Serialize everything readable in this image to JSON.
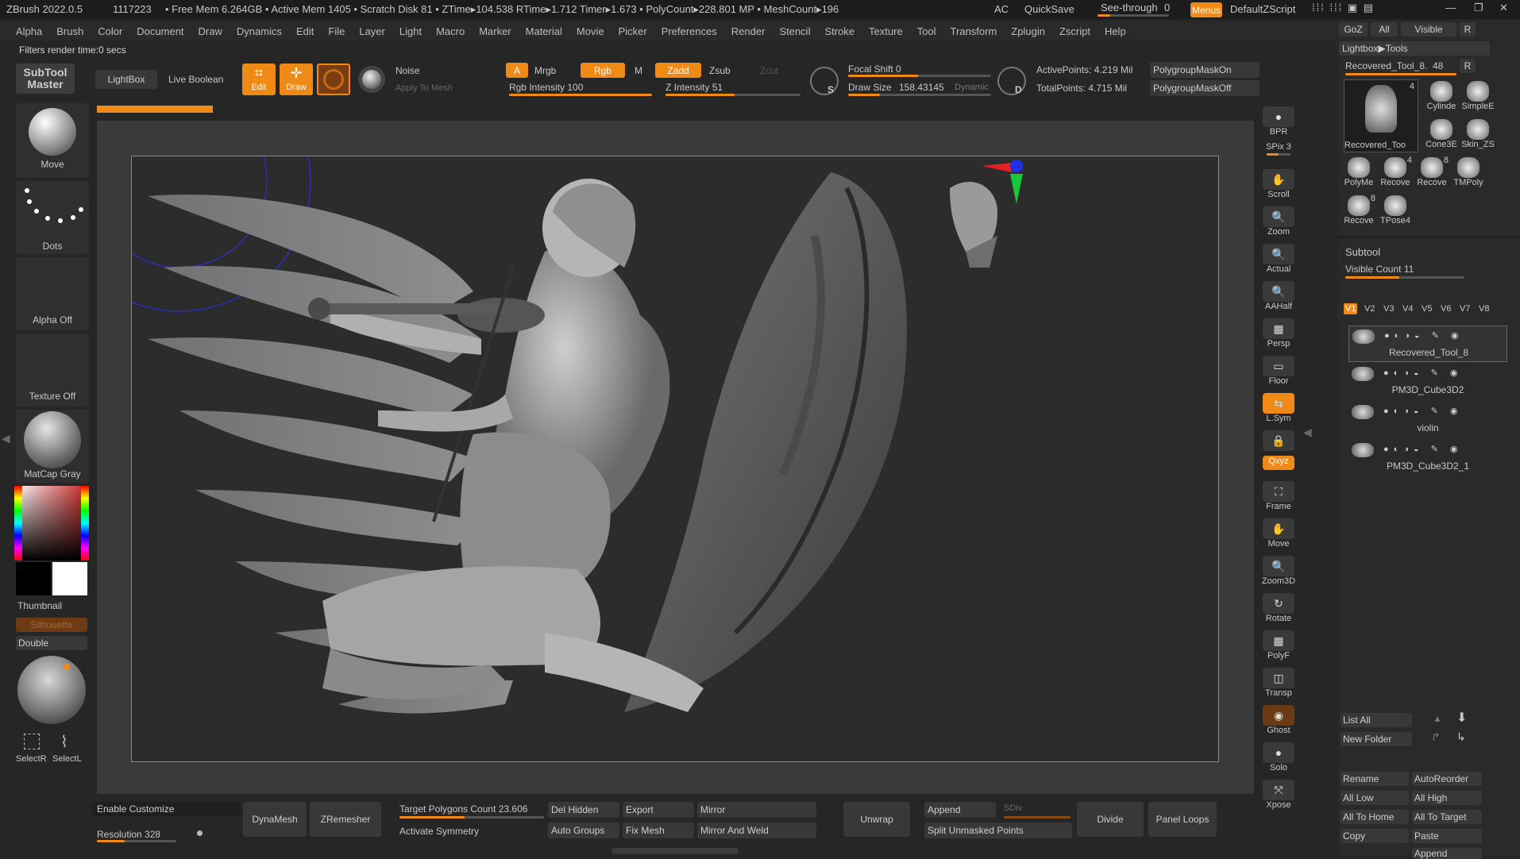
{
  "titlebar": {
    "app": "ZBrush 2022.0.5",
    "id": "1117223",
    "stats": "• Free Mem 6.264GB • Active Mem 1405 • Scratch Disk 81 • ZTime▸104.538 RTime▸1.712 Timer▸1.673 • PolyCount▸228.801 MP • MeshCount▸196",
    "ac": "AC",
    "quicksave": "QuickSave",
    "seethrough": "See-through",
    "seethrough_val": "0",
    "menus": "Menus",
    "script": "DefaultZScript"
  },
  "menus": [
    "Alpha",
    "Brush",
    "Color",
    "Document",
    "Draw",
    "Dynamics",
    "Edit",
    "File",
    "Layer",
    "Light",
    "Macro",
    "Marker",
    "Material",
    "Movie",
    "Picker",
    "Preferences",
    "Render",
    "Stencil",
    "Stroke",
    "Texture",
    "Tool",
    "Transform",
    "Zplugin",
    "Zscript",
    "Help"
  ],
  "status_msg": "Filters render time:0 secs",
  "toolbar": {
    "subtool_master": "SubTool Master",
    "lightbox": "LightBox",
    "live_boolean": "Live Boolean",
    "edit": "Edit",
    "draw": "Draw",
    "noise": "Noise",
    "apply_to_mesh": "Apply To Mesh",
    "a": "A",
    "mrgb": "Mrgb",
    "rgb": "Rgb",
    "m": "M",
    "zadd": "Zadd",
    "zsub": "Zsub",
    "zcut": "Zcut",
    "rgb_intensity": "Rgb Intensity 100",
    "z_intensity": "Z Intensity 51",
    "focal_shift": "Focal Shift 0",
    "draw_size_label": "Draw Size",
    "draw_size_val": "158.43145",
    "dynamic": "Dynamic",
    "s_label": "S",
    "d_label": "D",
    "active_points": "ActivePoints: 4.219 Mil",
    "total_points": "TotalPoints: 4.715 Mil",
    "pg_on": "PolygroupMaskOn",
    "pg_off": "PolygroupMaskOff"
  },
  "progress": {
    "fraction": 0.1
  },
  "left": {
    "move": "Move",
    "dots": "Dots",
    "alpha_off": "Alpha Off",
    "texture_off": "Texture Off",
    "matcap": "MatCap Gray",
    "thumbnail": "Thumbnail",
    "silhouette": "Silhouette",
    "double": "Double",
    "selectr": "SelectR",
    "selectl": "SelectL"
  },
  "right_shelf": [
    {
      "name": "bpr",
      "label": "BPR"
    },
    {
      "name": "spix",
      "label": "SPix 3"
    },
    {
      "name": "scroll",
      "label": "Scroll"
    },
    {
      "name": "zoom",
      "label": "Zoom"
    },
    {
      "name": "actual",
      "label": "Actual"
    },
    {
      "name": "aahalf",
      "label": "AAHalf"
    },
    {
      "name": "persp",
      "label": "Persp"
    },
    {
      "name": "floor",
      "label": "Floor"
    },
    {
      "name": "lsym",
      "label": "L.Sym"
    },
    {
      "name": "lock",
      "label": ""
    },
    {
      "name": "xyz",
      "label": "Qxyz"
    },
    {
      "name": "frame",
      "label": "Frame"
    },
    {
      "name": "move",
      "label": "Move"
    },
    {
      "name": "zoom3d",
      "label": "Zoom3D"
    },
    {
      "name": "rotate",
      "label": "Rotate"
    },
    {
      "name": "polyf",
      "label": "PolyF"
    },
    {
      "name": "transp",
      "label": "Transp"
    },
    {
      "name": "ghost",
      "label": "Ghost"
    },
    {
      "name": "solo",
      "label": "Solo"
    },
    {
      "name": "xpose",
      "label": "Xpose"
    }
  ],
  "toolpanel": {
    "goz": "GoZ",
    "all": "All",
    "visible": "Visible",
    "r": "R",
    "lightbox_tools": "Lightbox▶Tools",
    "current_tool": "Recovered_Tool_8.",
    "current_tool_num": "48",
    "big_thumb_count": "4",
    "big_thumb_label": "Recovered_Too",
    "thumbs": [
      {
        "label": "Cylinde",
        "count": ""
      },
      {
        "label": "SimpleE",
        "count": ""
      },
      {
        "label": "Cone3E",
        "count": ""
      },
      {
        "label": "Skin_ZS",
        "count": ""
      },
      {
        "label": "PolyMe",
        "count": ""
      },
      {
        "label": "Recove",
        "count": "4"
      },
      {
        "label": "Recove",
        "count": "8"
      },
      {
        "label": "TMPoly",
        "count": ""
      },
      {
        "label": "Recove",
        "count": "8"
      },
      {
        "label": "TPose4",
        "count": ""
      }
    ],
    "subtool_title": "Subtool",
    "visible_count": "Visible Count 11",
    "versions": [
      "V1",
      "V2",
      "V3",
      "V4",
      "V5",
      "V6",
      "V7",
      "V8"
    ],
    "subtools": [
      "Recovered_Tool_8",
      "PM3D_Cube3D2",
      "violin",
      "PM3D_Cube3D2_1"
    ],
    "list_all": "List All",
    "new_folder": "New Folder",
    "rename": "Rename",
    "autoreorder": "AutoReorder",
    "all_low": "All Low",
    "all_high": "All High",
    "all_to_home": "All To Home",
    "all_to_target": "All To Target",
    "copy": "Copy",
    "paste": "Paste",
    "append": "Append"
  },
  "bottom": {
    "enable_customize": "Enable Customize",
    "resolution": "Resolution 328",
    "dynamesh": "DynaMesh",
    "zremesher": "ZRemesher",
    "target_polygons": "Target Polygons Count 23.606",
    "activate_symmetry": "Activate Symmetry",
    "del_hidden": "Del Hidden",
    "auto_groups": "Auto Groups",
    "export": "Export",
    "fix_mesh": "Fix Mesh",
    "mirror": "Mirror",
    "mirror_and_weld": "Mirror And Weld",
    "unwrap": "Unwrap",
    "append": "Append",
    "sdiv": "SDiv",
    "split_unmasked": "Split Unmasked Points",
    "divide": "Divide",
    "panel_loops": "Panel Loops"
  },
  "colors": {
    "accent": "#f08a16",
    "bg": "#262626",
    "canvas": "#3a3a3a"
  }
}
